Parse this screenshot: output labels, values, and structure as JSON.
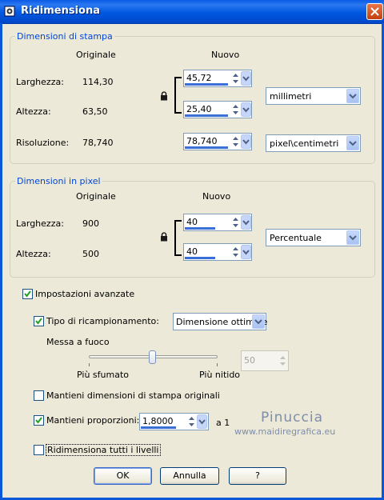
{
  "window": {
    "title": "Ridimensiona",
    "close_icon": "close-icon",
    "app_icon": "app-icon"
  },
  "print_size": {
    "title": "Dimensioni di stampa",
    "col_original": "Originale",
    "col_new": "Nuovo",
    "width_label": "Larghezza:",
    "width_original": "114,30",
    "width_new": "45,72",
    "height_label": "Altezza:",
    "height_original": "63,50",
    "height_new": "25,40",
    "unit": "millimetri",
    "resolution_label": "Risoluzione:",
    "resolution_original": "78,740",
    "resolution_new": "78,740",
    "resolution_unit": "pixel\\centimetri"
  },
  "pixel_size": {
    "title": "Dimensioni in pixel",
    "col_original": "Originale",
    "col_new": "Nuovo",
    "width_label": "Larghezza:",
    "width_original": "900",
    "width_new": "40",
    "height_label": "Altezza:",
    "height_original": "500",
    "height_new": "40",
    "unit": "Percentuale"
  },
  "advanced": {
    "advanced_settings_label": "Impostazioni avanzate",
    "advanced_settings_checked": true,
    "resample_label": "Tipo di ricampionamento:",
    "resample_checked": true,
    "resample_value": "Dimensione ottimale",
    "sharpness_label": "Messa a fuoco",
    "sharpness_value": "50",
    "slider_left_label": "Più sfumato",
    "slider_right_label": "Più nitido",
    "keep_print_label": "Mantieni dimensioni di stampa originali",
    "keep_print_checked": false,
    "keep_ratio_label": "Mantieni proporzioni:",
    "keep_ratio_checked": true,
    "ratio_value": "1,8000",
    "ratio_suffix": "a 1",
    "resize_all_label": "Ridimensiona tutti i livelli",
    "resize_all_checked": false
  },
  "buttons": {
    "ok": "OK",
    "cancel": "Annulla",
    "help": "?"
  },
  "watermark": {
    "name": "Pinuccia",
    "url": "www.maidiregrafica.eu"
  },
  "colors": {
    "titlebar": "#0058e0",
    "group_title": "#0046d5",
    "background": "#ece9d8"
  }
}
